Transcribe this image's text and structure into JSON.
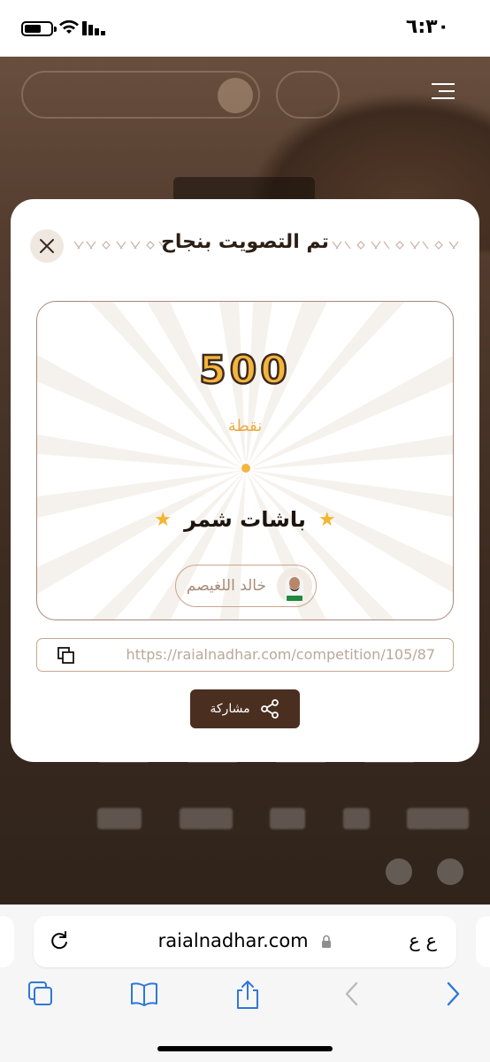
{
  "status_bar": {
    "time": "٦:٣٠"
  },
  "modal": {
    "title": "تم التصويت بنجاح",
    "points": "500",
    "points_label": "نقطة",
    "team_name": "باشات شمر",
    "player_name": "خالد اللغيصم",
    "link": "https://raialnadhar.com/competition/105/87",
    "share_label": "مشاركة",
    "accent_color": "#f5b43c",
    "brown_color": "#4a2f21"
  },
  "safari": {
    "url": "raialnadhar.com",
    "aa_label": "ع ع"
  },
  "icons": [
    "close-icon",
    "copy-icon",
    "share-icon",
    "star-icon",
    "reload-icon",
    "lock-icon",
    "tabs-icon",
    "bookmarks-icon",
    "share-sheet-icon",
    "back-icon",
    "forward-icon",
    "hamburger-icon"
  ]
}
